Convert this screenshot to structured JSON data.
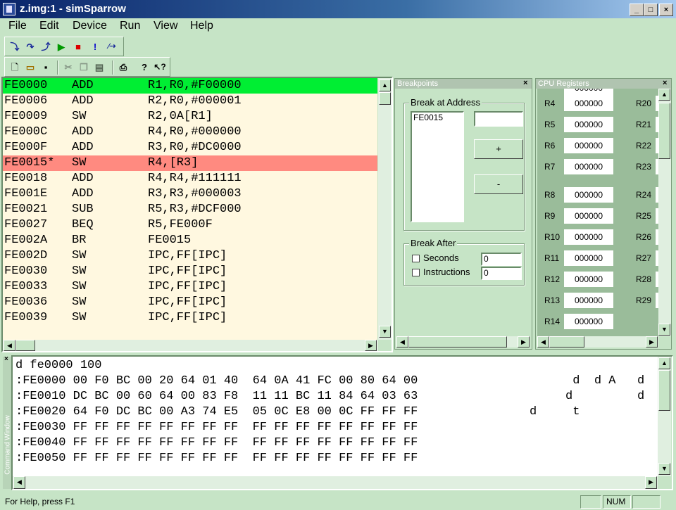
{
  "window": {
    "title": "z.img:1 - simSparrow",
    "buttons": {
      "minimize": "_",
      "maximize": "□",
      "close": "×"
    }
  },
  "menu": [
    "File",
    "Edit",
    "Device",
    "Run",
    "View",
    "Help"
  ],
  "toolbar1": [
    "step-into-icon",
    "step-over-icon",
    "step-out-icon",
    "run-icon",
    "stop-icon",
    "break-icon",
    "trace-icon"
  ],
  "toolbar2": [
    "new-icon",
    "open-icon",
    "save-icon",
    "cut-icon",
    "copy-icon",
    "paste-icon",
    "print-icon",
    "help-icon",
    "context-help-icon"
  ],
  "colors": {
    "current_line": "#00ee33",
    "breakpoint_line": "#ff8a80",
    "panel_bg": "#c6e4c6",
    "disasm_bg": "#fff8e0"
  },
  "disassembly": [
    {
      "addr": "FE0000",
      "op": "ADD",
      "args": "R1,R0,#F00000",
      "state": "current"
    },
    {
      "addr": "FE0006",
      "op": "ADD",
      "args": "R2,R0,#000001",
      "state": ""
    },
    {
      "addr": "FE0009",
      "op": "SW",
      "args": "R2,0A[R1]",
      "state": ""
    },
    {
      "addr": "FE000C",
      "op": "ADD",
      "args": "R4,R0,#000000",
      "state": ""
    },
    {
      "addr": "FE000F",
      "op": "ADD",
      "args": "R3,R0,#DC0000",
      "state": ""
    },
    {
      "addr": "FE0015*",
      "op": "SW",
      "args": "R4,[R3]",
      "state": "breakpoint"
    },
    {
      "addr": "FE0018",
      "op": "ADD",
      "args": "R4,R4,#111111",
      "state": ""
    },
    {
      "addr": "FE001E",
      "op": "ADD",
      "args": "R3,R3,#000003",
      "state": ""
    },
    {
      "addr": "FE0021",
      "op": "SUB",
      "args": "R5,R3,#DCF000",
      "state": ""
    },
    {
      "addr": "FE0027",
      "op": "BEQ",
      "args": "R5,FE000F",
      "state": ""
    },
    {
      "addr": "FE002A",
      "op": "BR",
      "args": "FE0015",
      "state": ""
    },
    {
      "addr": "FE002D",
      "op": "SW",
      "args": "IPC,FF[IPC]",
      "state": ""
    },
    {
      "addr": "FE0030",
      "op": "SW",
      "args": "IPC,FF[IPC]",
      "state": ""
    },
    {
      "addr": "FE0033",
      "op": "SW",
      "args": "IPC,FF[IPC]",
      "state": ""
    },
    {
      "addr": "FE0036",
      "op": "SW",
      "args": "IPC,FF[IPC]",
      "state": ""
    },
    {
      "addr": "FE0039",
      "op": "SW",
      "args": "IPC,FF[IPC]",
      "state": ""
    }
  ],
  "breakpoints": {
    "title": "Breakpoints",
    "break_at_address": "Break at Address",
    "list": [
      "FE0015"
    ],
    "address_value": "",
    "add_label": "+",
    "remove_label": "-",
    "break_after": "Break After",
    "seconds_label": "Seconds",
    "seconds_value": "0",
    "instructions_label": "Instructions",
    "instructions_value": "0"
  },
  "registers": {
    "title": "CPU Registers",
    "rows": [
      {
        "left": "R4",
        "value": "000000",
        "right": "R20"
      },
      {
        "left": "R5",
        "value": "000000",
        "right": "R21"
      },
      {
        "left": "R6",
        "value": "000000",
        "right": "R22"
      },
      {
        "left": "R7",
        "value": "000000",
        "right": "R23"
      },
      {
        "left": "R8",
        "value": "000000",
        "right": "R24"
      },
      {
        "left": "R9",
        "value": "000000",
        "right": "R25"
      },
      {
        "left": "R10",
        "value": "000000",
        "right": "R26"
      },
      {
        "left": "R11",
        "value": "000000",
        "right": "R27"
      },
      {
        "left": "R12",
        "value": "000000",
        "right": "R28"
      },
      {
        "left": "R13",
        "value": "000000",
        "right": "R29"
      },
      {
        "left": "R14",
        "value": "000000",
        "right": ""
      }
    ],
    "partial_top_value": "000000"
  },
  "command_window": {
    "side_label": "Command Window",
    "lines": [
      {
        "hex": "d fe0000 100",
        "ascii": ""
      },
      {
        "hex": ":FE0000 00 F0 BC 00 20 64 01 40  64 0A 41 FC 00 80 64 00",
        "ascii": "      d  d A   d"
      },
      {
        "hex": ":FE0010 DC BC 00 60 64 00 83 F8  11 11 BC 11 84 64 03 63",
        "ascii": "     d         d"
      },
      {
        "hex": ":FE0020 64 F0 DC BC 00 A3 74 E5  05 0C E8 00 0C FF FF FF",
        "ascii": "d     t"
      },
      {
        "hex": ":FE0030 FF FF FF FF FF FF FF FF  FF FF FF FF FF FF FF FF",
        "ascii": ""
      },
      {
        "hex": ":FE0040 FF FF FF FF FF FF FF FF  FF FF FF FF FF FF FF FF",
        "ascii": ""
      },
      {
        "hex": ":FE0050 FF FF FF FF FF FF FF FF  FF FF FF FF FF FF FF FF",
        "ascii": ""
      }
    ]
  },
  "status": {
    "help": "For Help, press F1",
    "num": "NUM"
  }
}
